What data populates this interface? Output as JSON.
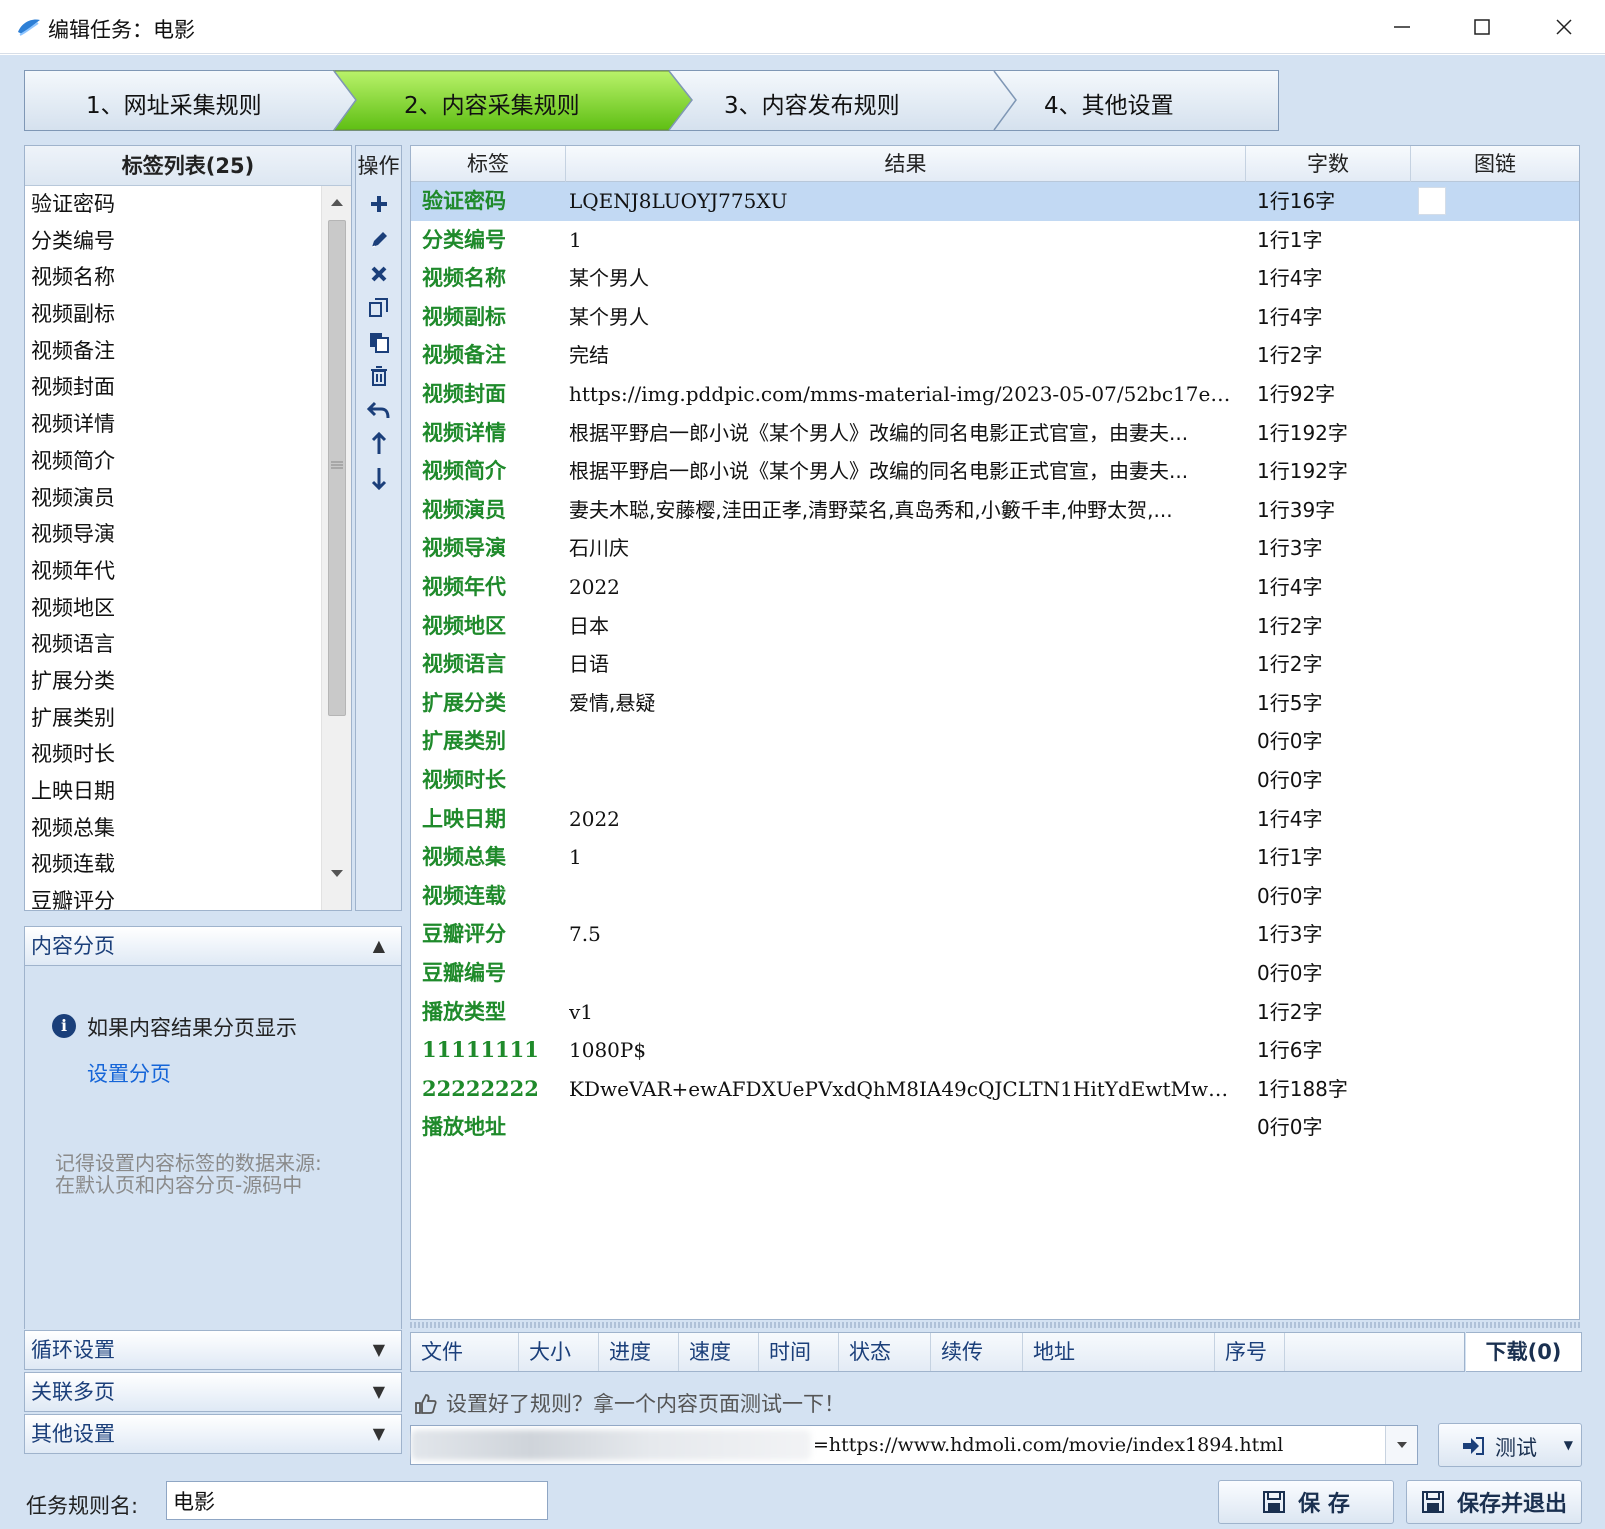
{
  "window": {
    "title": "编辑任务：电影"
  },
  "steps": [
    {
      "label": "1、网址采集规则",
      "active": false
    },
    {
      "label": "2、内容采集规则",
      "active": true
    },
    {
      "label": "3、内容发布规则",
      "active": false
    },
    {
      "label": "4、其他设置",
      "active": false
    }
  ],
  "taglist": {
    "title": "标签列表(25)",
    "items": [
      "验证密码",
      "分类编号",
      "视频名称",
      "视频副标",
      "视频备注",
      "视频封面",
      "视频详情",
      "视频简介",
      "视频演员",
      "视频导演",
      "视频年代",
      "视频地区",
      "视频语言",
      "扩展分类",
      "扩展类别",
      "视频时长",
      "上映日期",
      "视频总集",
      "视频连载",
      "豆瓣评分"
    ]
  },
  "ops": {
    "title": "操作",
    "buttons": [
      "plus-icon",
      "pencil-icon",
      "delete-icon",
      "copy-icon",
      "paste-icon",
      "trash-icon",
      "undo-icon",
      "arrow-up-icon",
      "arrow-down-icon"
    ]
  },
  "grid": {
    "columns": [
      "标签",
      "结果",
      "字数",
      "图链"
    ],
    "rows": [
      {
        "tag": "验证密码",
        "result": "LQENJ8LUOYJ775XU",
        "count": "1行16字",
        "selected": true
      },
      {
        "tag": "分类编号",
        "result": "1",
        "count": "1行1字"
      },
      {
        "tag": "视频名称",
        "result": "某个男人",
        "count": "1行4字"
      },
      {
        "tag": "视频副标",
        "result": "某个男人",
        "count": "1行4字"
      },
      {
        "tag": "视频备注",
        "result": "完结",
        "count": "1行2字"
      },
      {
        "tag": "视频封面",
        "result": "https://img.pddpic.com/mms-material-img/2023-05-07/52bc17e0-0...",
        "count": "1行92字"
      },
      {
        "tag": "视频详情",
        "result": "根据平野启一郎小说《某个男人》改编的同名电影正式官宣，由妻夫...",
        "count": "1行192字"
      },
      {
        "tag": "视频简介",
        "result": "根据平野启一郎小说《某个男人》改编的同名电影正式官宣，由妻夫...",
        "count": "1行192字"
      },
      {
        "tag": "视频演员",
        "result": "妻夫木聪,安藤樱,洼田正孝,清野菜名,真岛秀和,小籔千丰,仲野太贺,...",
        "count": "1行39字"
      },
      {
        "tag": "视频导演",
        "result": "石川庆",
        "count": "1行3字"
      },
      {
        "tag": "视频年代",
        "result": "2022",
        "count": "1行4字"
      },
      {
        "tag": "视频地区",
        "result": "日本",
        "count": "1行2字"
      },
      {
        "tag": "视频语言",
        "result": "日语",
        "count": "1行2字"
      },
      {
        "tag": "扩展分类",
        "result": "爱情,悬疑",
        "count": "1行5字"
      },
      {
        "tag": "扩展类别",
        "result": "",
        "count": "0行0字"
      },
      {
        "tag": "视频时长",
        "result": "",
        "count": "0行0字"
      },
      {
        "tag": "上映日期",
        "result": "2022",
        "count": "1行4字"
      },
      {
        "tag": "视频总集",
        "result": "1",
        "count": "1行1字"
      },
      {
        "tag": "视频连载",
        "result": "",
        "count": "0行0字"
      },
      {
        "tag": "豆瓣评分",
        "result": "7.5",
        "count": "1行3字"
      },
      {
        "tag": "豆瓣编号",
        "result": "",
        "count": "0行0字"
      },
      {
        "tag": "播放类型",
        "result": "v1",
        "count": "1行2字"
      },
      {
        "tag": "11111111",
        "result": "1080P$",
        "count": "1行6字"
      },
      {
        "tag": "22222222",
        "result": "KDweVAR+ewAFDXUePVxdQhM8IA49cQJCLTN1HitYdEwtMwpUBHUDXCtGfBIFB...",
        "count": "1行188字"
      },
      {
        "tag": "播放地址",
        "result": "",
        "count": "0行0字"
      }
    ]
  },
  "pager": {
    "title": "内容分页",
    "info": "如果内容结果分页显示",
    "link": "设置分页",
    "hint1": "记得设置内容标签的数据来源:",
    "hint2": "在默认页和内容分页-源码中"
  },
  "sections": [
    "循环设置",
    "关联多页",
    "其他设置"
  ],
  "download": {
    "columns": [
      "文件",
      "大小",
      "进度",
      "速度",
      "时间",
      "状态",
      "续传",
      "地址",
      "序号"
    ],
    "count_label": "下载(0)"
  },
  "test": {
    "hint": "设置好了规则？拿一个内容页面测试一下！",
    "url": "=https://www.hdmoli.com/movie/index1894.html",
    "button": "测试"
  },
  "footer": {
    "rule_name_label": "任务规则名:",
    "rule_name_value": "电影",
    "save": "保 存",
    "save_exit": "保存并退出"
  },
  "colors": {
    "active_step": "#7ed321",
    "tag_green": "#1f8a2b",
    "link_blue": "#1565d8",
    "panel_bg": "#d4e2f2"
  }
}
